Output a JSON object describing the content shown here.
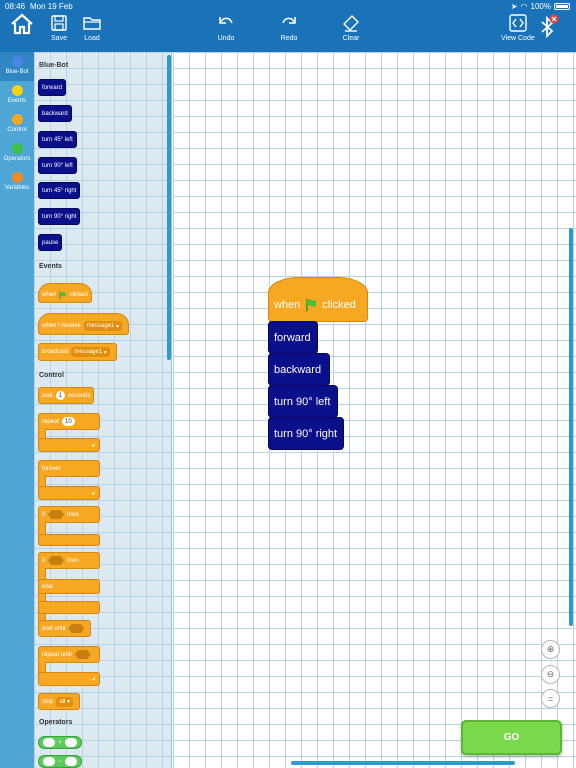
{
  "status": {
    "time": "08:46",
    "date": "Mon 19 Feb",
    "battery": "100%"
  },
  "toolbar": {
    "save": "Save",
    "load": "Load",
    "undo": "Undo",
    "redo": "Redo",
    "clear": "Clear",
    "view_code": "View Code"
  },
  "categories": [
    {
      "label": "Blue-Bot",
      "color": "#4a86e8"
    },
    {
      "label": "Events",
      "color": "#f5d312"
    },
    {
      "label": "Control",
      "color": "#f5a623"
    },
    {
      "label": "Operators",
      "color": "#3cc24a"
    },
    {
      "label": "Variables",
      "color": "#f58a23"
    }
  ],
  "palette": {
    "headings": {
      "bluebot": "Blue-Bot",
      "events": "Events",
      "control": "Control",
      "operators": "Operators"
    },
    "motion": [
      "forward",
      "backward",
      "turn 45° left",
      "turn 90° left",
      "turn 45° right",
      "turn 90° right",
      "pause"
    ],
    "events": {
      "when": "when",
      "clicked": "clicked",
      "when_receive": "when I receive",
      "message1": "message1",
      "broadcast": "broadcast",
      "message1b": "message1"
    },
    "control": {
      "wait": "wait",
      "wait_value": "1",
      "seconds": "seconds",
      "repeat": "repeat",
      "repeat_value": "10",
      "forever": "forever",
      "if": "if",
      "then": "then",
      "if2": "if",
      "then2": "then",
      "else": "else",
      "wait_until": "wait until",
      "repeat_until": "repeat until",
      "stop": "stop",
      "stop_option": "all"
    },
    "operators": {
      "plus": "+",
      "minus": "−"
    }
  },
  "workspace": {
    "hat": {
      "when": "when",
      "clicked": "clicked"
    },
    "blocks": [
      "forward",
      "backward",
      "turn 90° left",
      "turn 90° right"
    ]
  },
  "zoom": {
    "in": "+",
    "out": "−",
    "reset": "="
  },
  "go": "GO"
}
